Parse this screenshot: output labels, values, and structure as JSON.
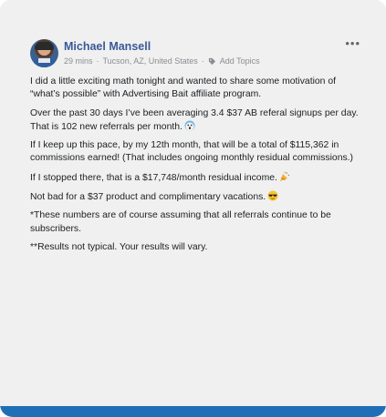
{
  "post": {
    "author": "Michael Mansell",
    "time": "29 mins",
    "location": "Tucson, AZ, United States",
    "add_topics": "Add Topics",
    "paragraphs": [
      "I did a little exciting math tonight and wanted to share some motivation of “what’s possible” with Advertising Bait affiliate program.",
      "Over the past 30 days I’ve been averaging 3.4 $37 AB referal signups per day. That is 102 new referrals per month.",
      "If I keep up this pace, by my 12th month, that will be a total of $115,362 in commissions earned! (That includes ongoing monthly residual commissions.)",
      "If I stopped there, that is a $17,748/month residual income.",
      "Not bad for a $37 product and complimentary vacations.",
      "*These numbers are of course assuming that all referrals continue to be subscribers.",
      "**Results not typical. Your results will vary."
    ]
  },
  "icons": {
    "more": "more-options-icon",
    "tag": "tag-icon",
    "emoji_shocked": "shocked-face-icon",
    "emoji_party": "party-popper-icon",
    "emoji_cool": "sunglasses-face-icon"
  },
  "colors": {
    "author": "#3b5998",
    "accent_bar": "#1f6fb6",
    "card_bg": "#f0f0f0"
  }
}
